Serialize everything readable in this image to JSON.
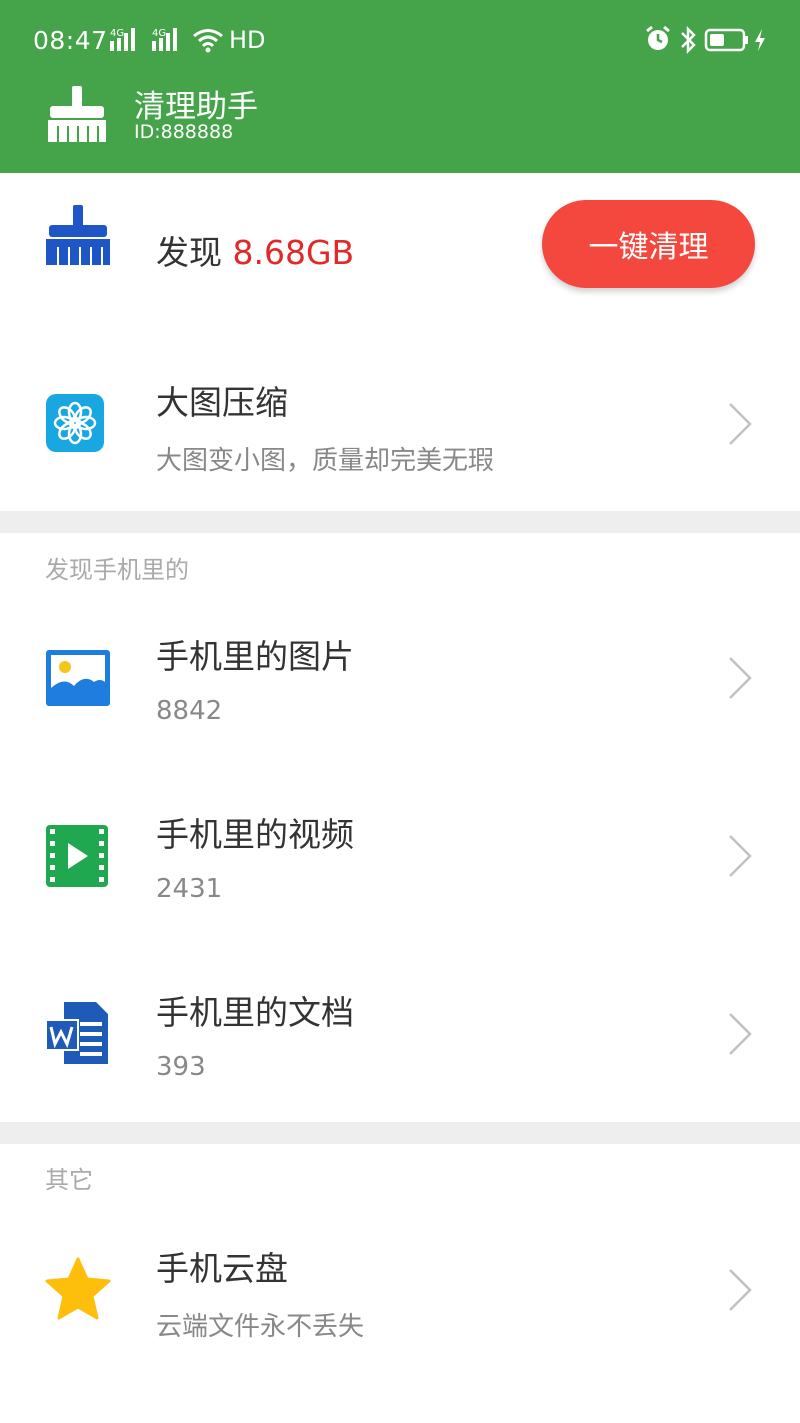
{
  "status_bar": {
    "time": "08:47",
    "network1": "4G",
    "network2": "4G",
    "hd": "HD"
  },
  "app": {
    "title": "清理助手",
    "id_text": "ID:888888"
  },
  "summary": {
    "prefix": "发现",
    "size": "8.68GB",
    "clean_button": "一键清理"
  },
  "compress": {
    "title": "大图压缩",
    "subtitle": "大图变小图，质量却完美无瑕"
  },
  "section_phone": {
    "label": "发现手机里的",
    "items": [
      {
        "title": "手机里的图片",
        "count": "8842",
        "icon": "image-icon"
      },
      {
        "title": "手机里的视频",
        "count": "2431",
        "icon": "video-icon"
      },
      {
        "title": "手机里的文档",
        "count": "393",
        "icon": "document-icon"
      }
    ]
  },
  "section_other": {
    "label": "其它",
    "items": [
      {
        "title": "手机云盘",
        "subtitle": "云端文件永不丢失",
        "icon": "star-icon"
      }
    ]
  },
  "colors": {
    "header_green": "#45a349",
    "accent_red": "#f4473e",
    "size_red": "#e02a2a"
  }
}
